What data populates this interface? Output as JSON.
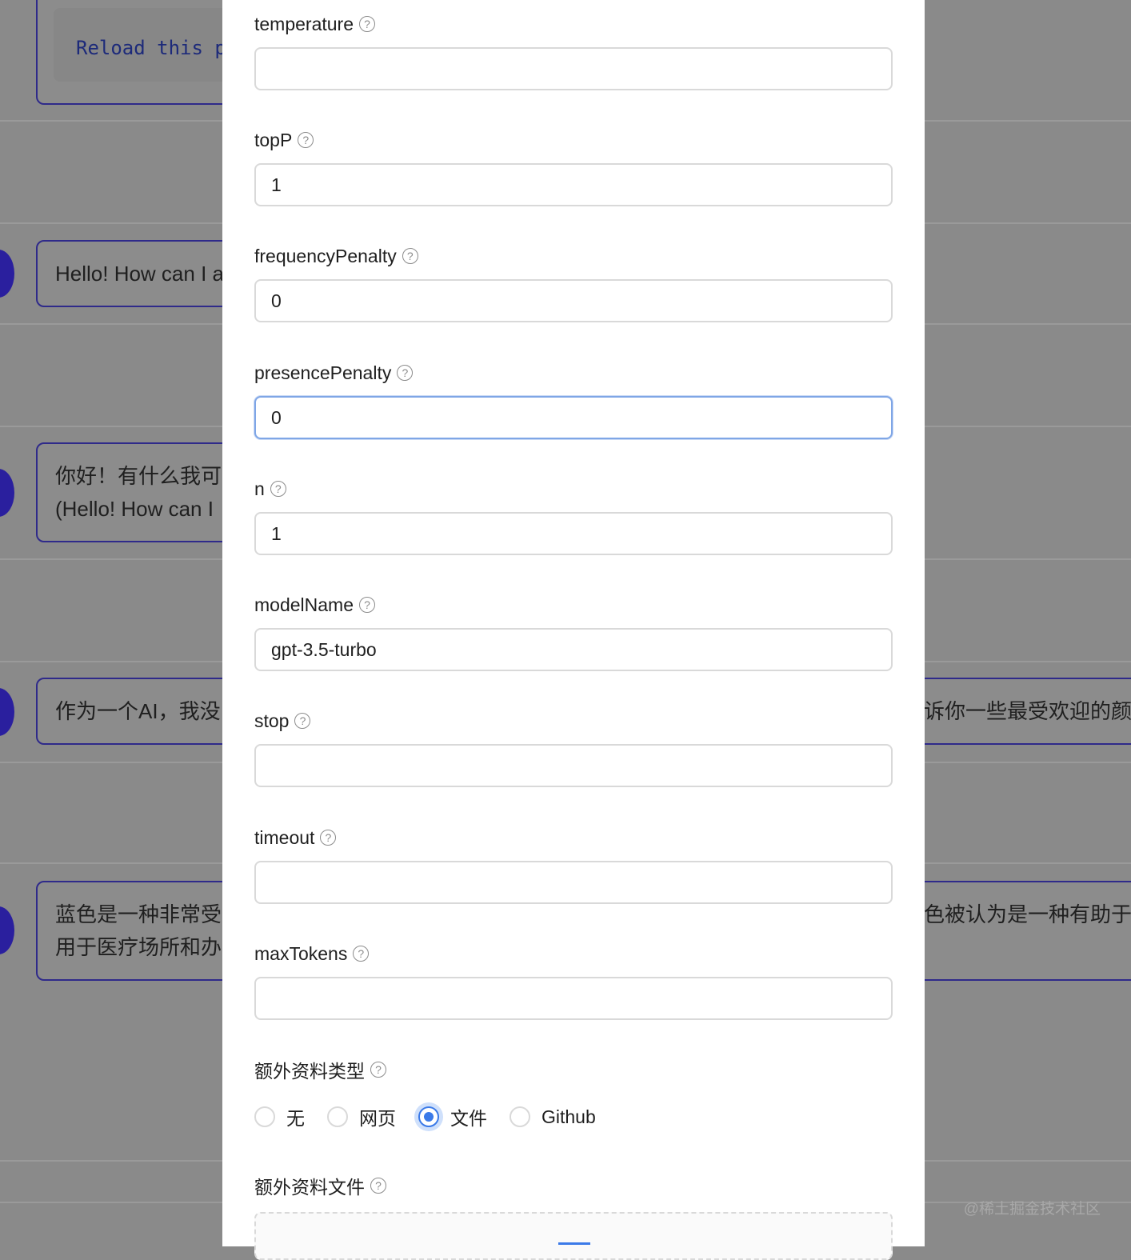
{
  "background": {
    "code_text": "Reload this pa",
    "bubbles": [
      {
        "lines": [
          "Hello! How can I a"
        ]
      },
      {
        "lines": [
          "你好！有什么我可",
          "(Hello! How can I"
        ]
      },
      {
        "lines": [
          "作为一个AI，我没"
        ],
        "right_text": "诉你一些最受欢迎的颜"
      },
      {
        "lines": [
          "蓝色是一种非常受",
          "用于医疗场所和办"
        ],
        "right_text": "色被认为是一种有助于"
      }
    ],
    "watermark": "@稀土掘金技术社区"
  },
  "form": {
    "fields": [
      {
        "label": "temperature",
        "value": ""
      },
      {
        "label": "topP",
        "value": "1"
      },
      {
        "label": "frequencyPenalty",
        "value": "0"
      },
      {
        "label": "presencePenalty",
        "value": "0"
      },
      {
        "label": "n",
        "value": "1"
      },
      {
        "label": "modelName",
        "value": "gpt-3.5-turbo"
      },
      {
        "label": "stop",
        "value": ""
      },
      {
        "label": "timeout",
        "value": ""
      },
      {
        "label": "maxTokens",
        "value": ""
      }
    ],
    "extra_type": {
      "label": "额外资料类型",
      "options": [
        "无",
        "网页",
        "文件",
        "Github"
      ],
      "selected": "文件"
    },
    "extra_file": {
      "label": "额外资料文件"
    },
    "accent_color": "#3b7ae8"
  }
}
